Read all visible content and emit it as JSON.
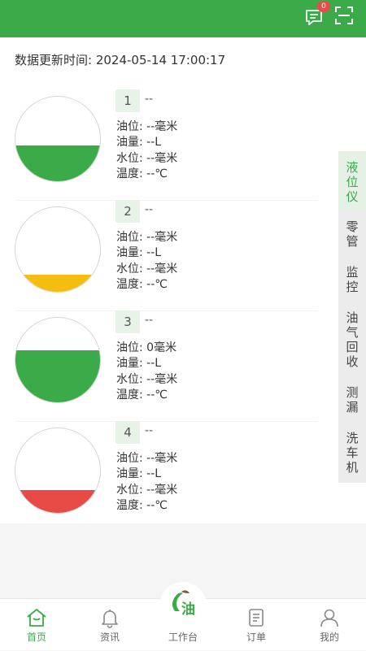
{
  "header": {
    "badge_count": "0",
    "icons": {
      "message": "message-icon",
      "scan": "scan-icon"
    },
    "background_color": "#3aab48"
  },
  "update_time": "数据更新时间: 2024-05-14 17:00:17",
  "labels": {
    "oil_level": "油位:",
    "oil_volume": "油量:",
    "water_level": "水位:",
    "temperature": "温度:"
  },
  "tanks": [
    {
      "number": "1",
      "name": "--",
      "oil_level": "--毫米",
      "oil_volume": "--L",
      "water_level": "--毫米",
      "temperature": "--℃",
      "fill_fraction": 0.42,
      "fill_color": "#3aab48"
    },
    {
      "number": "2",
      "name": "--",
      "oil_level": "--毫米",
      "oil_volume": "--L",
      "water_level": "--毫米",
      "temperature": "--℃",
      "fill_fraction": 0.2,
      "fill_color": "#f5bd0f"
    },
    {
      "number": "3",
      "name": "--",
      "oil_level": "0毫米",
      "oil_volume": "--L",
      "water_level": "--毫米",
      "temperature": "--℃",
      "fill_fraction": 0.62,
      "fill_color": "#3aab48"
    },
    {
      "number": "4",
      "name": "--",
      "oil_level": "--毫米",
      "oil_volume": "--L",
      "water_level": "--毫米",
      "temperature": "--℃",
      "fill_fraction": 0.27,
      "fill_color": "#e84b45"
    }
  ],
  "side_tabs": [
    {
      "label": "液位仪",
      "chars": [
        "液",
        "位",
        "仪"
      ],
      "active": true
    },
    {
      "label": "零管",
      "chars": [
        "零",
        "管"
      ],
      "active": false
    },
    {
      "label": "监控",
      "chars": [
        "监",
        "控"
      ],
      "active": false
    },
    {
      "label": "油气回收",
      "chars": [
        "油",
        "气",
        "回",
        "收"
      ],
      "active": false
    },
    {
      "label": "测漏",
      "chars": [
        "测",
        "漏"
      ],
      "active": false
    },
    {
      "label": "洗车机",
      "chars": [
        "洗",
        "车",
        "机"
      ],
      "active": false
    }
  ],
  "bottom_nav": [
    {
      "label": "首页",
      "icon": "home-icon",
      "active": true
    },
    {
      "label": "资讯",
      "icon": "bell-icon",
      "active": false
    },
    {
      "label": "工作台",
      "icon": "oil-logo-icon",
      "active": false
    },
    {
      "label": "订单",
      "icon": "order-list-icon",
      "active": false
    },
    {
      "label": "我的",
      "icon": "user-icon",
      "active": false
    }
  ],
  "colors": {
    "primary": "#3aab48",
    "warning": "#f5bd0f",
    "danger": "#e84b45"
  }
}
